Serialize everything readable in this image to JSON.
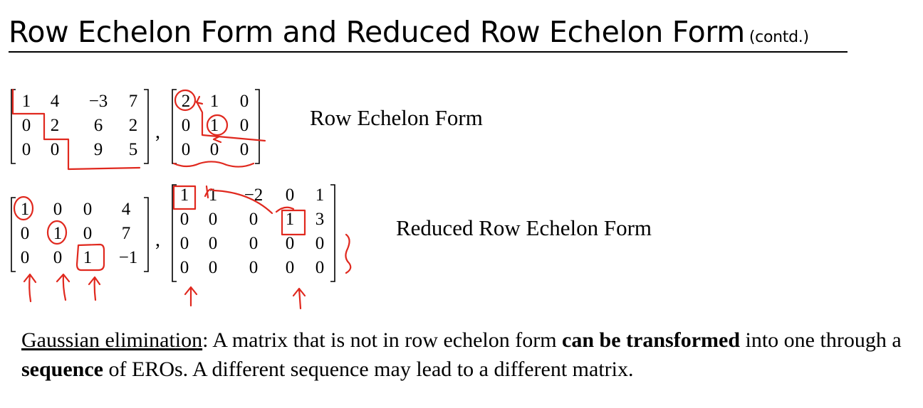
{
  "slide": {
    "title": "Row Echelon Form and Reduced Row Echelon Form",
    "title_suffix": "(contd.)",
    "separator": ",",
    "ref_label": "Row Echelon Form",
    "rref_label": "Reduced Row Echelon Form",
    "paragraph": {
      "term": "Gaussian elimination",
      "p1": ": A matrix that is not in row echelon form ",
      "bold1": "can be transformed",
      "p2": " into one through a ",
      "bold2": "sequence",
      "p3": " of EROs. A different sequence may lead to a different matrix."
    }
  },
  "matrices": {
    "ref_a": [
      [
        "1",
        "4",
        "−3",
        "7"
      ],
      [
        "0",
        "2",
        "6",
        "2"
      ],
      [
        "0",
        "0",
        "9",
        "5"
      ]
    ],
    "ref_b": [
      [
        "2",
        "1",
        "0"
      ],
      [
        "0",
        "1",
        "0"
      ],
      [
        "0",
        "0",
        "0"
      ]
    ],
    "rref_a": [
      [
        "1",
        "0",
        "0",
        "4"
      ],
      [
        "0",
        "1",
        "0",
        "7"
      ],
      [
        "0",
        "0",
        "1",
        "−1"
      ]
    ],
    "rref_b": [
      [
        "1",
        "1",
        "−2",
        "0",
        "1"
      ],
      [
        "0",
        "0",
        "0",
        "1",
        "3"
      ],
      [
        "0",
        "0",
        "0",
        "0",
        "0"
      ],
      [
        "0",
        "0",
        "0",
        "0",
        "0"
      ]
    ]
  },
  "colors": {
    "ink": "#000000",
    "annotation": "#e0281e"
  }
}
